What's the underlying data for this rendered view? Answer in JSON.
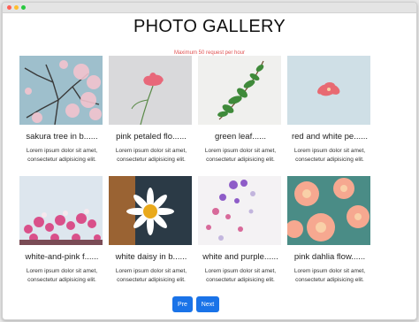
{
  "window": {
    "controls": [
      "close",
      "minimize",
      "maximize"
    ]
  },
  "header": {
    "title": "PHOTO GALLERY",
    "notice": "Maximum 50 request per hour",
    "notice_color": "#e05050"
  },
  "gallery": {
    "photos": [
      {
        "caption": "sakura tree in b......",
        "description": "Lorem ipsum dolor sit amet,\nconsectetur adipisicing elit.",
        "image": "sakura-tree"
      },
      {
        "caption": "pink petaled flo......",
        "description": "Lorem ipsum dolor sit amet,\nconsectetur adipisicing elit.",
        "image": "pink-flower"
      },
      {
        "caption": "green leaf......",
        "description": "Lorem ipsum dolor sit amet,\nconsectetur adipisicing elit.",
        "image": "green-leaf"
      },
      {
        "caption": "red and white pe......",
        "description": "Lorem ipsum dolor sit amet,\nconsectetur adipisicing elit.",
        "image": "red-white-petals"
      },
      {
        "caption": "white-and-pink f......",
        "description": "Lorem ipsum dolor sit amet,\nconsectetur adipisicing elit.",
        "image": "white-pink-flowers"
      },
      {
        "caption": "white daisy in b......",
        "description": "Lorem ipsum dolor sit amet,\nconsectetur adipisicing elit.",
        "image": "white-daisy"
      },
      {
        "caption": "white and purple......",
        "description": "Lorem ipsum dolor sit amet,\nconsectetur adipisicing elit.",
        "image": "white-purple-flowers"
      },
      {
        "caption": "pink dahlia flow......",
        "description": "Lorem ipsum dolor sit amet,\nconsectetur adipisicing elit.",
        "image": "pink-dahlia"
      }
    ]
  },
  "pagination": {
    "prev_label": "Pre",
    "next_label": "Next",
    "button_color": "#1a73e8"
  }
}
